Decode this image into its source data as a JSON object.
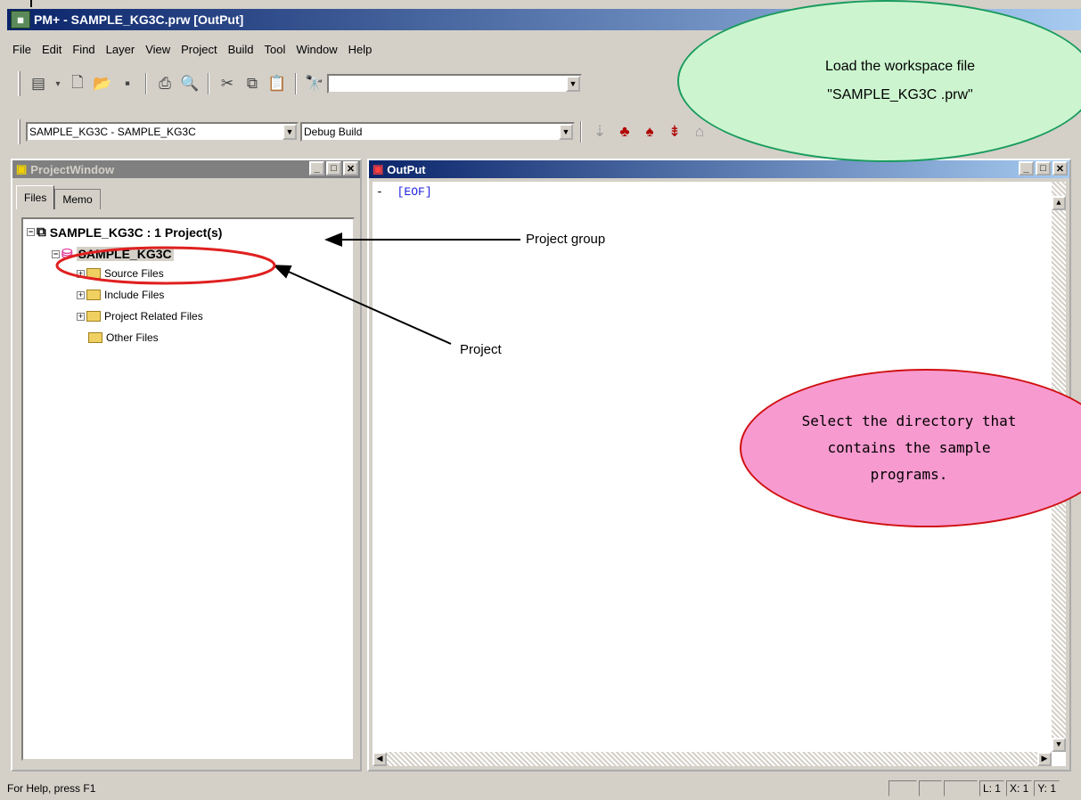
{
  "window": {
    "title": "PM+ - SAMPLE_KG3C.prw [OutPut]"
  },
  "menu": [
    "File",
    "Edit",
    "Find",
    "Layer",
    "View",
    "Project",
    "Build",
    "Tool",
    "Window",
    "Help"
  ],
  "toolbar2": {
    "project_combo": "SAMPLE_KG3C - SAMPLE_KG3C",
    "build_combo": "Debug Build"
  },
  "project_window": {
    "title": "ProjectWindow",
    "tabs": [
      "Files",
      "Memo"
    ],
    "tree": {
      "group": "SAMPLE_KG3C : 1 Project(s)",
      "project": "SAMPLE_KG3C",
      "folders": [
        "Source Files",
        "Include Files",
        "Project Related Files",
        "Other Files"
      ]
    }
  },
  "output_window": {
    "title": "OutPut",
    "lines": [
      {
        "dash": "-",
        "text": "[EOF]"
      }
    ]
  },
  "status": {
    "help": "For Help, press F1",
    "line": "L: 1",
    "x": "X: 1",
    "y": "Y: 1"
  },
  "annotations": {
    "project_group": "Project group",
    "project": "Project",
    "load_workspace": [
      "Load the workspace file",
      "\"SAMPLE_KG3C .prw\""
    ],
    "select_directory": [
      "Select the directory that",
      "contains the sample",
      "programs."
    ]
  }
}
